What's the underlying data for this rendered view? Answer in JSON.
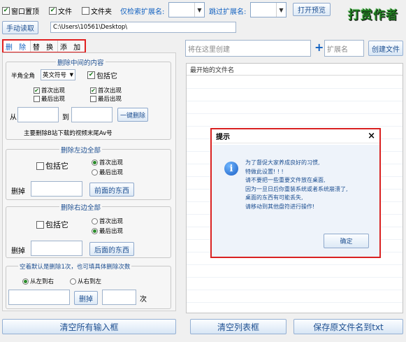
{
  "toolbar": {
    "window_top": "窗口置顶",
    "file": "文件",
    "folder": "文件夹",
    "search_ext_label": "仅检索扩展名:",
    "skip_ext_label": "跳过扩展名:",
    "open_preview": "打开预览",
    "logo": "打赏作者",
    "manual_read": "手动读取",
    "path": "C:\\Users\\10561\\Desktop\\"
  },
  "tabs": [
    "删 除",
    "替 换",
    "添 加"
  ],
  "delete_panel": {
    "middle": {
      "title": "删除中间的内容",
      "width_label": "半角全角",
      "width_value": "英文符号",
      "include": "包括它",
      "left_first": "首次出现",
      "left_last": "最后出现",
      "right_first": "首次出现",
      "right_last": "最后出现",
      "from": "从",
      "to": "到",
      "one_click": "一键删除",
      "hint": "主要删除B站下载的视频末尾Av号"
    },
    "left": {
      "title": "删除左边全部",
      "include": "包括它",
      "first": "首次出现",
      "last": "最后出现",
      "delete_label": "删掉",
      "button": "前面的东西"
    },
    "right": {
      "title": "删除右边全部",
      "include": "包括它",
      "first": "首次出现",
      "last": "最后出现",
      "delete_label": "删掉",
      "button": "后面的东西"
    },
    "count": {
      "title": "空着默认是删除1次，也可填具体删除次数",
      "ltr": "从左到右",
      "rtl": "从右到左",
      "delete_btn": "删掉",
      "times": "次"
    }
  },
  "right_panel": {
    "create_placeholder": "将在这里创建",
    "plus": "+",
    "ext_placeholder": "扩展名",
    "create_btn": "创建文件",
    "list_header": "最开始的文件名"
  },
  "bottom": {
    "clear_inputs": "清空所有输入框",
    "clear_list": "清空列表框",
    "save_names": "保存原文件名到txt"
  },
  "dialog": {
    "title": "提示",
    "close": "×",
    "lines": [
      "为了督促大家养成良好的习惯,",
      "特做此设置! ! !",
      "请不要把一些重要文件放在桌面,",
      "因为一旦日后你重装系统或者系统崩溃了,",
      "桌面的东西有可能丢失,",
      "请移动到其他盘符进行操作!"
    ],
    "ok": "确定"
  },
  "colors": {
    "accent": "#1060c0",
    "highlight_border": "#e02020",
    "check_green": "#1a7a1a"
  }
}
